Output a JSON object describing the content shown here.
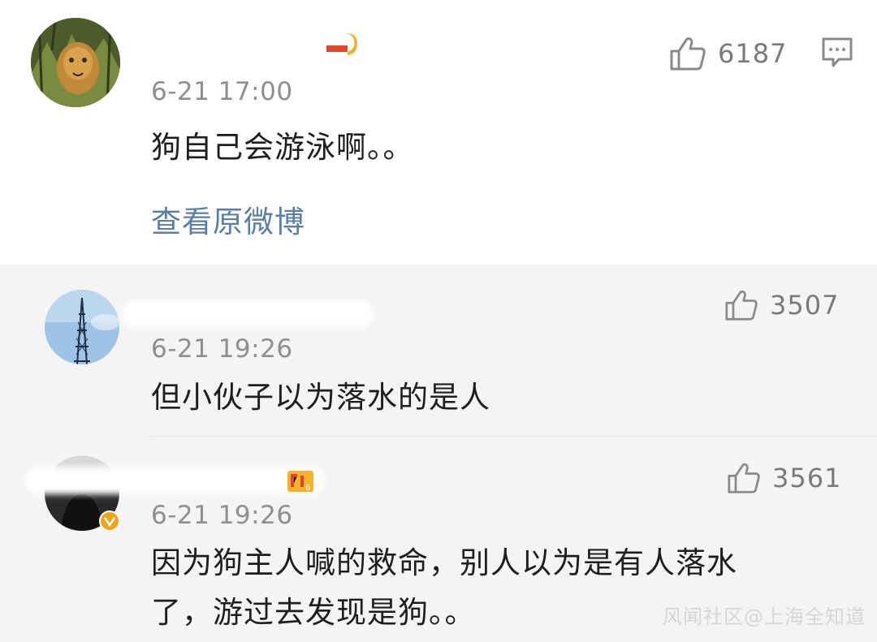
{
  "main_comment": {
    "time": "6-21 17:00",
    "text": "狗自己会游泳啊。。",
    "like_count": "6187",
    "view_original_link": "查看原微博"
  },
  "replies": [
    {
      "time": "6-21 19:26",
      "text": "但小伙子以为落水的是人",
      "like_count": "3507"
    },
    {
      "time": "6-21 19:26",
      "text_line1": "因为狗主人喊的救命，别人以为是有人落水",
      "text_line2": "了，游过去发现是狗。。",
      "like_count": "3561"
    }
  ],
  "watermark": "风闻社区@上海全知道",
  "colors": {
    "reply_background": "#f4f4f4",
    "link": "#5b7ea6",
    "meta_text": "#8f8f8f",
    "verified_badge": "#f0a21a"
  },
  "icons": [
    "thumbs-up-icon",
    "comment-icon",
    "verified-badge-icon",
    "level-badge-icon"
  ]
}
